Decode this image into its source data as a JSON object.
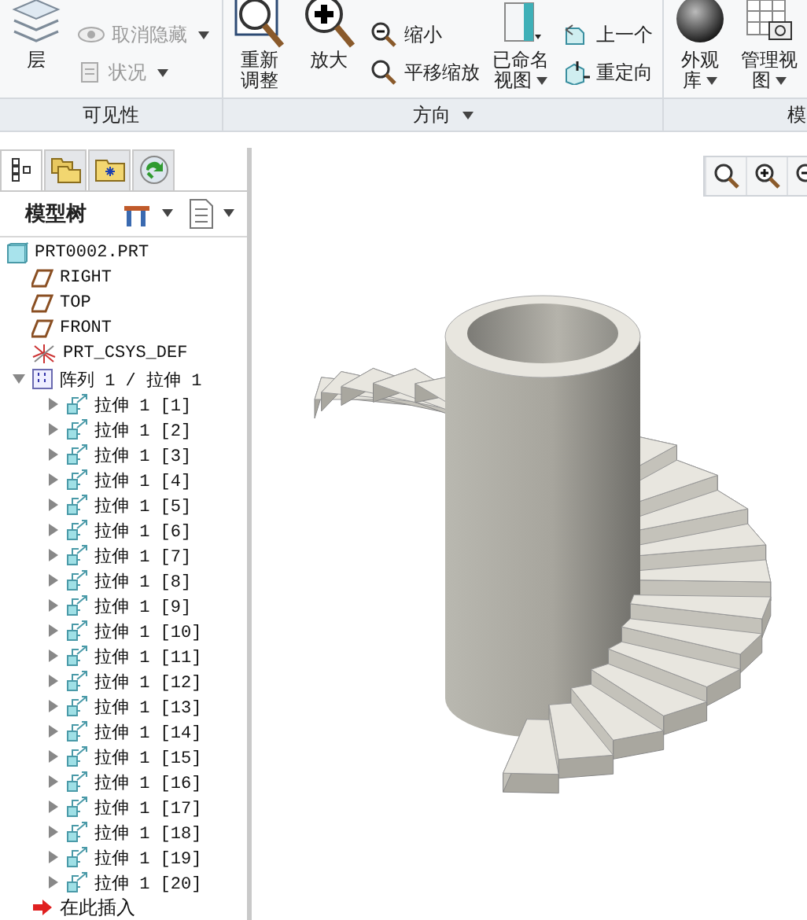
{
  "ribbon": {
    "groups": [
      {
        "label": "可见性",
        "menu": false,
        "items": [
          {
            "kind": "large",
            "lines": [
              "层"
            ],
            "menu": false
          },
          {
            "kind": "stack",
            "entries": [
              {
                "label": "取消隐藏",
                "disabled": true,
                "menu": true
              },
              {
                "label": "状况",
                "disabled": true,
                "menu": true
              }
            ]
          }
        ]
      },
      {
        "label": "方向",
        "menu": true,
        "items": [
          {
            "kind": "large",
            "lines": [
              "重新",
              "调整"
            ],
            "menu": false
          },
          {
            "kind": "large",
            "lines": [
              "放大"
            ],
            "menu": false
          },
          {
            "kind": "stack",
            "entries": [
              {
                "label": "缩小",
                "disabled": false,
                "menu": false
              },
              {
                "label": "平移缩放",
                "disabled": false,
                "menu": false
              }
            ]
          },
          {
            "kind": "large",
            "lines": [
              "已命名",
              "视图"
            ],
            "menu": true
          },
          {
            "kind": "stack",
            "entries": [
              {
                "label": "上一个",
                "disabled": false,
                "menu": false
              },
              {
                "label": "重定向",
                "disabled": false,
                "menu": false
              }
            ]
          }
        ]
      },
      {
        "label": "模",
        "menu": false,
        "items": [
          {
            "kind": "large",
            "lines": [
              "外观",
              "库"
            ],
            "menu": true
          },
          {
            "kind": "large",
            "lines": [
              "管理视",
              "图"
            ],
            "menu": true
          }
        ]
      }
    ]
  },
  "panel": {
    "tabs": [
      {
        "selected": true
      },
      {
        "selected": false
      },
      {
        "selected": false
      },
      {
        "selected": false
      }
    ],
    "title": "模型树"
  },
  "tree": [
    {
      "kind": "part",
      "label": "PRT0002.PRT",
      "children": [
        {
          "kind": "plane",
          "label": "RIGHT"
        },
        {
          "kind": "plane",
          "label": "TOP"
        },
        {
          "kind": "plane",
          "label": "FRONT"
        },
        {
          "kind": "csys",
          "label": "PRT_CSYS_DEF"
        },
        {
          "kind": "pattern",
          "label": "阵列 1 / 拉伸 1",
          "expanded": true,
          "children": [
            {
              "kind": "feature",
              "label": "拉伸 1 [1]",
              "expanded": false
            },
            {
              "kind": "feature",
              "label": "拉伸 1 [2]",
              "expanded": false
            },
            {
              "kind": "feature",
              "label": "拉伸 1 [3]",
              "expanded": false
            },
            {
              "kind": "feature",
              "label": "拉伸 1 [4]",
              "expanded": false
            },
            {
              "kind": "feature",
              "label": "拉伸 1 [5]",
              "expanded": false
            },
            {
              "kind": "feature",
              "label": "拉伸 1 [6]",
              "expanded": false
            },
            {
              "kind": "feature",
              "label": "拉伸 1 [7]",
              "expanded": false
            },
            {
              "kind": "feature",
              "label": "拉伸 1 [8]",
              "expanded": false
            },
            {
              "kind": "feature",
              "label": "拉伸 1 [9]",
              "expanded": false
            },
            {
              "kind": "feature",
              "label": "拉伸 1 [10]",
              "expanded": false
            },
            {
              "kind": "feature",
              "label": "拉伸 1 [11]",
              "expanded": false
            },
            {
              "kind": "feature",
              "label": "拉伸 1 [12]",
              "expanded": false
            },
            {
              "kind": "feature",
              "label": "拉伸 1 [13]",
              "expanded": false
            },
            {
              "kind": "feature",
              "label": "拉伸 1 [14]",
              "expanded": false
            },
            {
              "kind": "feature",
              "label": "拉伸 1 [15]",
              "expanded": false
            },
            {
              "kind": "feature",
              "label": "拉伸 1 [16]",
              "expanded": false
            },
            {
              "kind": "feature",
              "label": "拉伸 1 [17]",
              "expanded": false
            },
            {
              "kind": "feature",
              "label": "拉伸 1 [18]",
              "expanded": false
            },
            {
              "kind": "feature",
              "label": "拉伸 1 [19]",
              "expanded": false
            },
            {
              "kind": "feature",
              "label": "拉伸 1 [20]",
              "expanded": false
            }
          ]
        },
        {
          "kind": "insert",
          "label": "在此插入"
        }
      ]
    }
  ]
}
